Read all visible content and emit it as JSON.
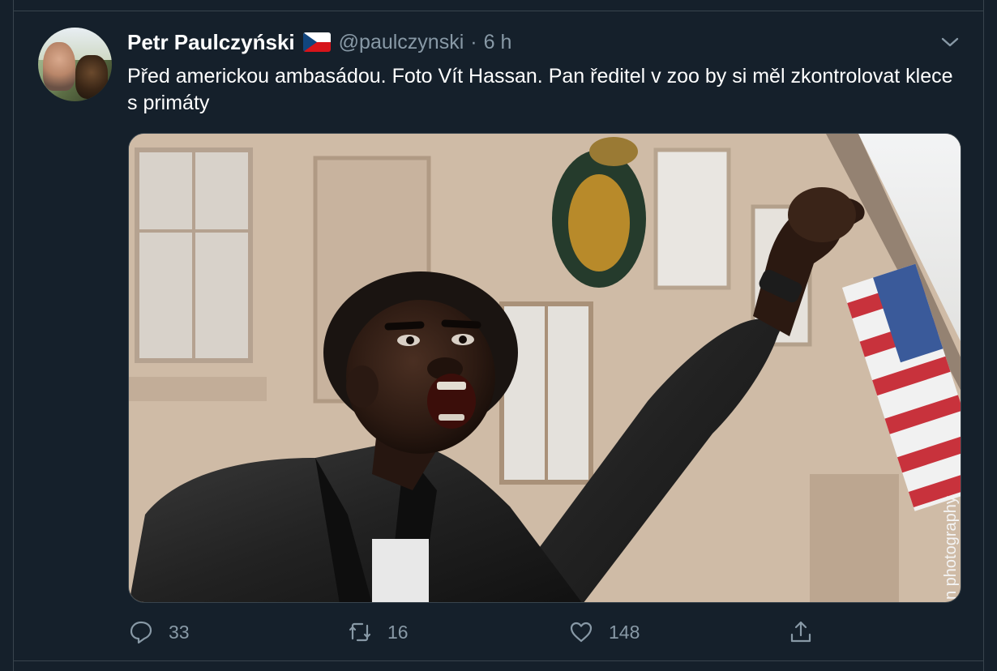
{
  "tweet": {
    "author_name": "Petr Paulczyński",
    "flag_icon": "czech-flag-icon",
    "handle": "@paulczynski",
    "separator": "·",
    "time": "6 h",
    "text": "Před americkou ambasádou. Foto Vít Hassan. Pan ředitel v zoo by si měl zkontrolovat klece s primáty",
    "image_watermark": "n photography"
  },
  "actions": {
    "reply": {
      "icon": "reply-icon",
      "count": "33"
    },
    "retweet": {
      "icon": "retweet-icon",
      "count": "16"
    },
    "like": {
      "icon": "heart-icon",
      "count": "148"
    },
    "share": {
      "icon": "share-icon"
    }
  },
  "colors": {
    "background": "#15202b",
    "border": "#38444d",
    "secondary_text": "#8899a6",
    "primary_text": "#ffffff"
  }
}
